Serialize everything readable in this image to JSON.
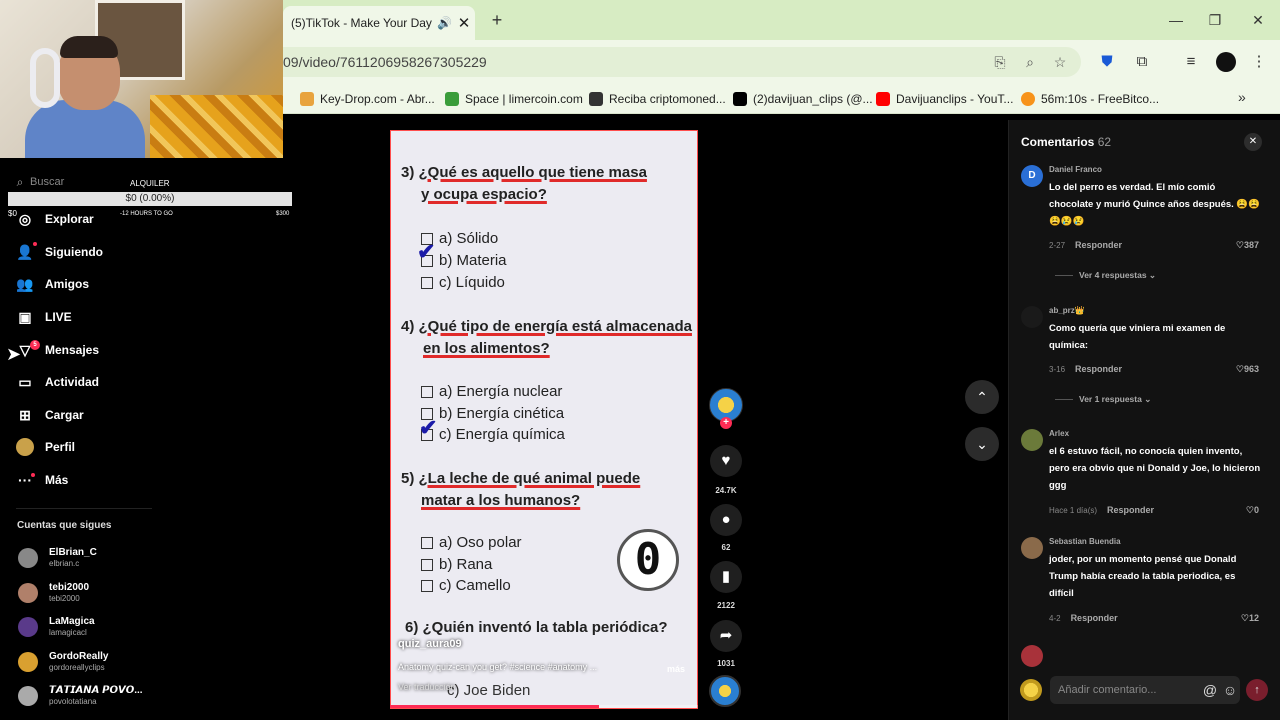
{
  "browser": {
    "tab_title": "(5)TikTok - Make Your Day",
    "address": "09/video/7611206958267305229",
    "bookmarks": [
      {
        "label": "Key-Drop.com - Abr...",
        "color": "#e8a33d"
      },
      {
        "label": "Space | limercoin.com",
        "color": "#3a9d3a"
      },
      {
        "label": "Reciba criptomoned...",
        "color": "#333333"
      },
      {
        "label": "(2)davijuan_clips (@...",
        "color": "#000000"
      },
      {
        "label": "Davijuanclips - YouT...",
        "color": "#ff0000"
      },
      {
        "label": "56m:10s - FreeBitco...",
        "color": "#f7931a"
      }
    ]
  },
  "overlay": {
    "label": "ALQUILER",
    "bar_text": "$0 (0.00%)",
    "left_value": "$0",
    "mid_text": "-12 HOURS TO GO",
    "right_value": "$300",
    "progress_fraction": 0.0
  },
  "sidebar": {
    "search_placeholder": "Buscar",
    "nav": [
      {
        "label": "Explorar",
        "icon": "compass-icon"
      },
      {
        "label": "Siguiendo",
        "icon": "user-follow-icon"
      },
      {
        "label": "Amigos",
        "icon": "friends-icon"
      },
      {
        "label": "LIVE",
        "icon": "live-tv-icon"
      },
      {
        "label": "Mensajes",
        "icon": "send-message-icon",
        "badge": "5"
      },
      {
        "label": "Actividad",
        "icon": "activity-icon"
      },
      {
        "label": "Cargar",
        "icon": "upload-icon"
      },
      {
        "label": "Perfil",
        "icon": "profile-avatar-icon"
      },
      {
        "label": "Más",
        "icon": "more-dots-icon"
      }
    ],
    "following_title": "Cuentas que sigues",
    "accounts": [
      {
        "name": "ElBrian_C",
        "handle": "elbrian.c",
        "color": "#888888"
      },
      {
        "name": "tebi2000",
        "handle": "tebi2000",
        "color": "#b0806a"
      },
      {
        "name": "LaMagica",
        "handle": "lamagicacl",
        "color": "#5a3a8a"
      },
      {
        "name": "GordoReally",
        "handle": "gordoreallyclips",
        "color": "#d9a030"
      },
      {
        "name": "𝙏𝘼𝙏𝙄𝘼𝙉𝘼 𝙋𝙊𝙑𝙊...",
        "handle": "povolotatiana",
        "color": "#aaaaaa"
      }
    ]
  },
  "video": {
    "q3": {
      "num": "3)",
      "line1": "¿Qué es aquello que tiene masa",
      "line2": "y ocupa espacio?",
      "options": [
        "a) Sólido",
        "b) Materia",
        "c) Líquido"
      ]
    },
    "q4": {
      "num": "4)",
      "line1": "¿Qué tipo de energía está almacenada",
      "line2": "en los alimentos?",
      "options": [
        "a) Energía nuclear",
        "b) Energía cinética",
        "c) Energía química"
      ]
    },
    "q5": {
      "num": "5)",
      "line1": "¿La leche de qué animal puede",
      "line2": "matar a los humanos?",
      "options": [
        "a) Oso polar",
        "b) Rana",
        "c) Camello"
      ]
    },
    "q6": {
      "num": "6)",
      "line1": "¿Quién inventó la tabla periódica?",
      "partial_option": "c) Joe Biden"
    },
    "timer": "0",
    "author": "quiz_aura09",
    "description": "Anatomy quiz-can you get? #science #anatomy ...",
    "more": "más",
    "translation": "Ver traducción",
    "progress_fraction": 0.68
  },
  "actions": {
    "likes": "24.7K",
    "comments": "62",
    "saves": "2122",
    "shares": "1031"
  },
  "comments": {
    "title": "Comentarios",
    "count": "62",
    "items": [
      {
        "user": "Daniel Franco",
        "initial": "D",
        "color": "#2a6fd6",
        "text": "Lo del perro es verdad. El mío comió chocolate y murió Quince años después. 😩😩😩😢😢",
        "date": "2-27",
        "reply": "Responder",
        "likes": "387",
        "more": "Ver 4 respuestas ⌄"
      },
      {
        "user": "ab_prz👑",
        "initial": "",
        "color": "#1a1a1a",
        "text": "Como quería que viniera mi examen de química:",
        "date": "3-16",
        "reply": "Responder",
        "likes": "963",
        "more": "Ver 1 respuesta ⌄"
      },
      {
        "user": "Arlex",
        "initial": "",
        "color": "#6b7a3a",
        "text": "el 6 estuvo fácil, no conocía quien invento, pero era obvio que ni Donald y Joe, lo hicieron ggg",
        "date": "Hace 1 día(s)",
        "reply": "Responder",
        "likes": "0"
      },
      {
        "user": "Sebastian Buendia",
        "initial": "",
        "color": "#8a6a4a",
        "text": "joder, por un momento pensé que Donald Trump había creado la tabla periodica, es difícil",
        "date": "4-2",
        "reply": "Responder",
        "likes": "12"
      }
    ],
    "input_placeholder": "Añadir comentario..."
  }
}
